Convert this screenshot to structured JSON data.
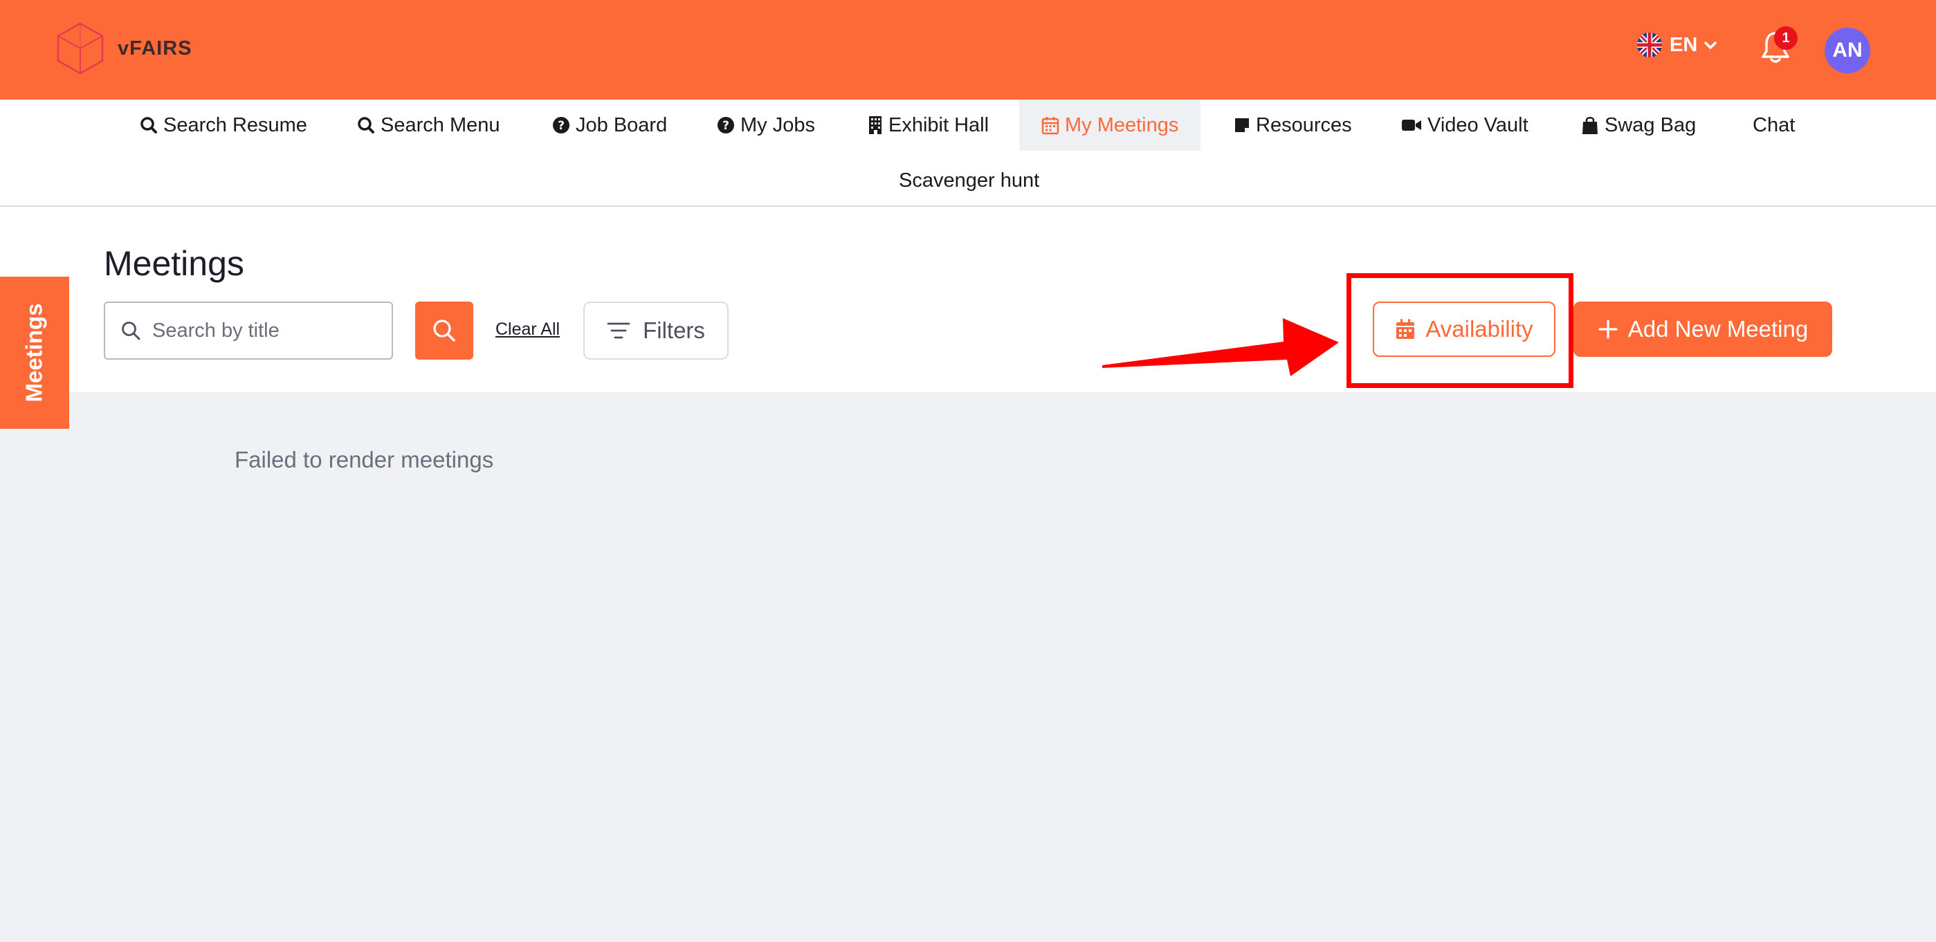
{
  "header": {
    "logo_text": "vFAIRS",
    "language": "EN",
    "notification_count": "1",
    "avatar_initials": "AN",
    "accent_color": "#fd6a38"
  },
  "nav": {
    "items": [
      {
        "label": "Search Resume",
        "icon": "search-icon"
      },
      {
        "label": "Search Menu",
        "icon": "search-icon"
      },
      {
        "label": "Job Board",
        "icon": "question-circle-icon"
      },
      {
        "label": "My Jobs",
        "icon": "question-circle-icon"
      },
      {
        "label": "Exhibit Hall",
        "icon": "building-icon"
      },
      {
        "label": "My Meetings",
        "icon": "calendar-icon",
        "active": true
      },
      {
        "label": "Resources",
        "icon": "note-icon"
      },
      {
        "label": "Video Vault",
        "icon": "video-camera-icon"
      },
      {
        "label": "Swag Bag",
        "icon": "shopping-bag-icon"
      },
      {
        "label": "Chat",
        "icon": ""
      },
      {
        "label": "Scavenger hunt",
        "icon": ""
      }
    ]
  },
  "sidebar_tab": {
    "label": "Meetings"
  },
  "meetings": {
    "title": "Meetings",
    "search_placeholder": "Search by title",
    "clear_all_label": "Clear All",
    "filters_label": "Filters",
    "availability_label": "Availability",
    "add_new_label": "Add New Meeting",
    "error_message": "Failed to render meetings"
  },
  "annotation": {
    "color": "#ff0000"
  }
}
